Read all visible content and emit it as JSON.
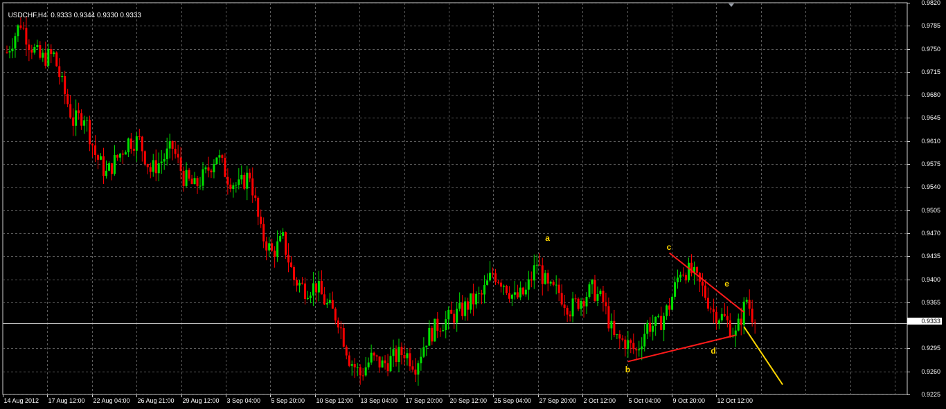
{
  "header": {
    "symbol": "USDCHF,H4",
    "ohlc": "0.9333 0.9344 0.9330 0.9333"
  },
  "current_price_label": "0.9333",
  "colors": {
    "background": "#000000",
    "grid": "#5a5a5a",
    "bull": "#00e000",
    "bear": "#ff0000",
    "wave_label": "#ffd700",
    "triangle": "#ff1a1a",
    "projection": "#ffd700"
  },
  "chart_data": {
    "type": "candlestick",
    "title": "USDCHF,H4",
    "y_axis": {
      "ylim": [
        0.9225,
        0.982
      ],
      "ticks": [
        "0.9820",
        "0.9785",
        "0.9750",
        "0.9715",
        "0.9680",
        "0.9645",
        "0.9610",
        "0.9575",
        "0.9540",
        "0.9505",
        "0.9470",
        "0.9435",
        "0.9400",
        "0.9365",
        "0.9333",
        "0.9295",
        "0.9260",
        "0.9225"
      ]
    },
    "x_axis": {
      "ticks": [
        "14 Aug 2012",
        "17 Aug 12:00",
        "22 Aug 04:00",
        "26 Aug 21:00",
        "29 Aug 12:00",
        "3 Sep 04:00",
        "5 Sep 20:00",
        "10 Sep 12:00",
        "13 Sep 04:00",
        "17 Sep 20:00",
        "20 Sep 12:00",
        "25 Sep 04:00",
        "27 Sep 20:00",
        "2 Oct 12:00",
        "5 Oct 04:00",
        "9 Oct 20:00",
        "12 Oct 12:00"
      ]
    },
    "grid": true,
    "current_price": 0.9333,
    "price_path": [
      [
        0,
        0.9745
      ],
      [
        5,
        0.979
      ],
      [
        8,
        0.976
      ],
      [
        12,
        0.9735
      ],
      [
        17,
        0.974
      ],
      [
        20,
        0.9695
      ],
      [
        24,
        0.964
      ],
      [
        28,
        0.965
      ],
      [
        32,
        0.959
      ],
      [
        36,
        0.956
      ],
      [
        40,
        0.9585
      ],
      [
        44,
        0.961
      ],
      [
        48,
        0.961
      ],
      [
        52,
        0.9565
      ],
      [
        56,
        0.958
      ],
      [
        60,
        0.96
      ],
      [
        64,
        0.9555
      ],
      [
        68,
        0.954
      ],
      [
        72,
        0.956
      ],
      [
        76,
        0.959
      ],
      [
        80,
        0.9555
      ],
      [
        84,
        0.954
      ],
      [
        88,
        0.956
      ],
      [
        92,
        0.947
      ],
      [
        96,
        0.944
      ],
      [
        100,
        0.946
      ],
      [
        104,
        0.94
      ],
      [
        108,
        0.9385
      ],
      [
        112,
        0.939
      ],
      [
        116,
        0.936
      ],
      [
        120,
        0.934
      ],
      [
        124,
        0.928
      ],
      [
        128,
        0.9255
      ],
      [
        132,
        0.928
      ],
      [
        136,
        0.927
      ],
      [
        140,
        0.928
      ],
      [
        144,
        0.929
      ],
      [
        148,
        0.927
      ],
      [
        152,
        0.931
      ],
      [
        156,
        0.933
      ],
      [
        160,
        0.934
      ],
      [
        164,
        0.935
      ],
      [
        168,
        0.9365
      ],
      [
        172,
        0.9375
      ],
      [
        176,
        0.941
      ],
      [
        180,
        0.9395
      ],
      [
        184,
        0.937
      ],
      [
        188,
        0.938
      ],
      [
        192,
        0.9425
      ],
      [
        196,
        0.9385
      ],
      [
        200,
        0.938
      ],
      [
        204,
        0.9355
      ],
      [
        208,
        0.937
      ],
      [
        212,
        0.9385
      ],
      [
        216,
        0.9365
      ],
      [
        220,
        0.931
      ],
      [
        224,
        0.9305
      ],
      [
        228,
        0.929
      ],
      [
        232,
        0.933
      ],
      [
        236,
        0.933
      ],
      [
        240,
        0.936
      ],
      [
        244,
        0.9415
      ],
      [
        248,
        0.941
      ],
      [
        252,
        0.9385
      ],
      [
        256,
        0.935
      ],
      [
        260,
        0.934
      ],
      [
        264,
        0.9315
      ],
      [
        268,
        0.937
      ],
      [
        271,
        0.9333
      ]
    ],
    "annotations": [
      {
        "label": "a",
        "x": 196,
        "y": 0.9462
      },
      {
        "label": "b",
        "x": 225,
        "y": 0.9262
      },
      {
        "label": "c",
        "x": 240,
        "y": 0.9448
      },
      {
        "label": "d",
        "x": 256,
        "y": 0.929
      },
      {
        "label": "e",
        "x": 261,
        "y": 0.9392
      }
    ],
    "triangle_upper": [
      [
        240,
        0.944
      ],
      [
        267,
        0.935
      ]
    ],
    "triangle_lower": [
      [
        225,
        0.9275
      ],
      [
        264,
        0.9315
      ]
    ],
    "projection": [
      [
        267,
        0.9328
      ],
      [
        281,
        0.924
      ]
    ]
  }
}
